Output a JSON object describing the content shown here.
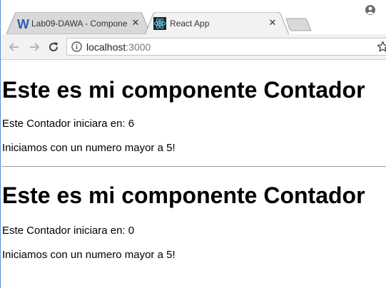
{
  "browser": {
    "tabs": [
      {
        "label": "Lab09-DAWA - Compone",
        "favicon": "W-icon",
        "active": false
      },
      {
        "label": "React App",
        "favicon": "react-icon",
        "active": true
      }
    ],
    "address": {
      "host": "localhost",
      "port": ":3000"
    }
  },
  "page": {
    "sections": [
      {
        "heading": "Este es mi componente Contador",
        "start_text": "Este Contador iniciara en: 6",
        "message": "Iniciamos con un numero mayor a 5!"
      },
      {
        "heading": "Este es mi componente Contador",
        "start_text": "Este Contador iniciara en: 0",
        "message": "Iniciamos con un numero mayor a 5!"
      }
    ]
  },
  "colors": {
    "active_tab_bg": "#f2f2f2",
    "inactive_tab_bg": "#d9d9d9",
    "window_border": "#5a8fd8",
    "word_blue": "#2b5fad",
    "react_cyan": "#61dafb"
  }
}
